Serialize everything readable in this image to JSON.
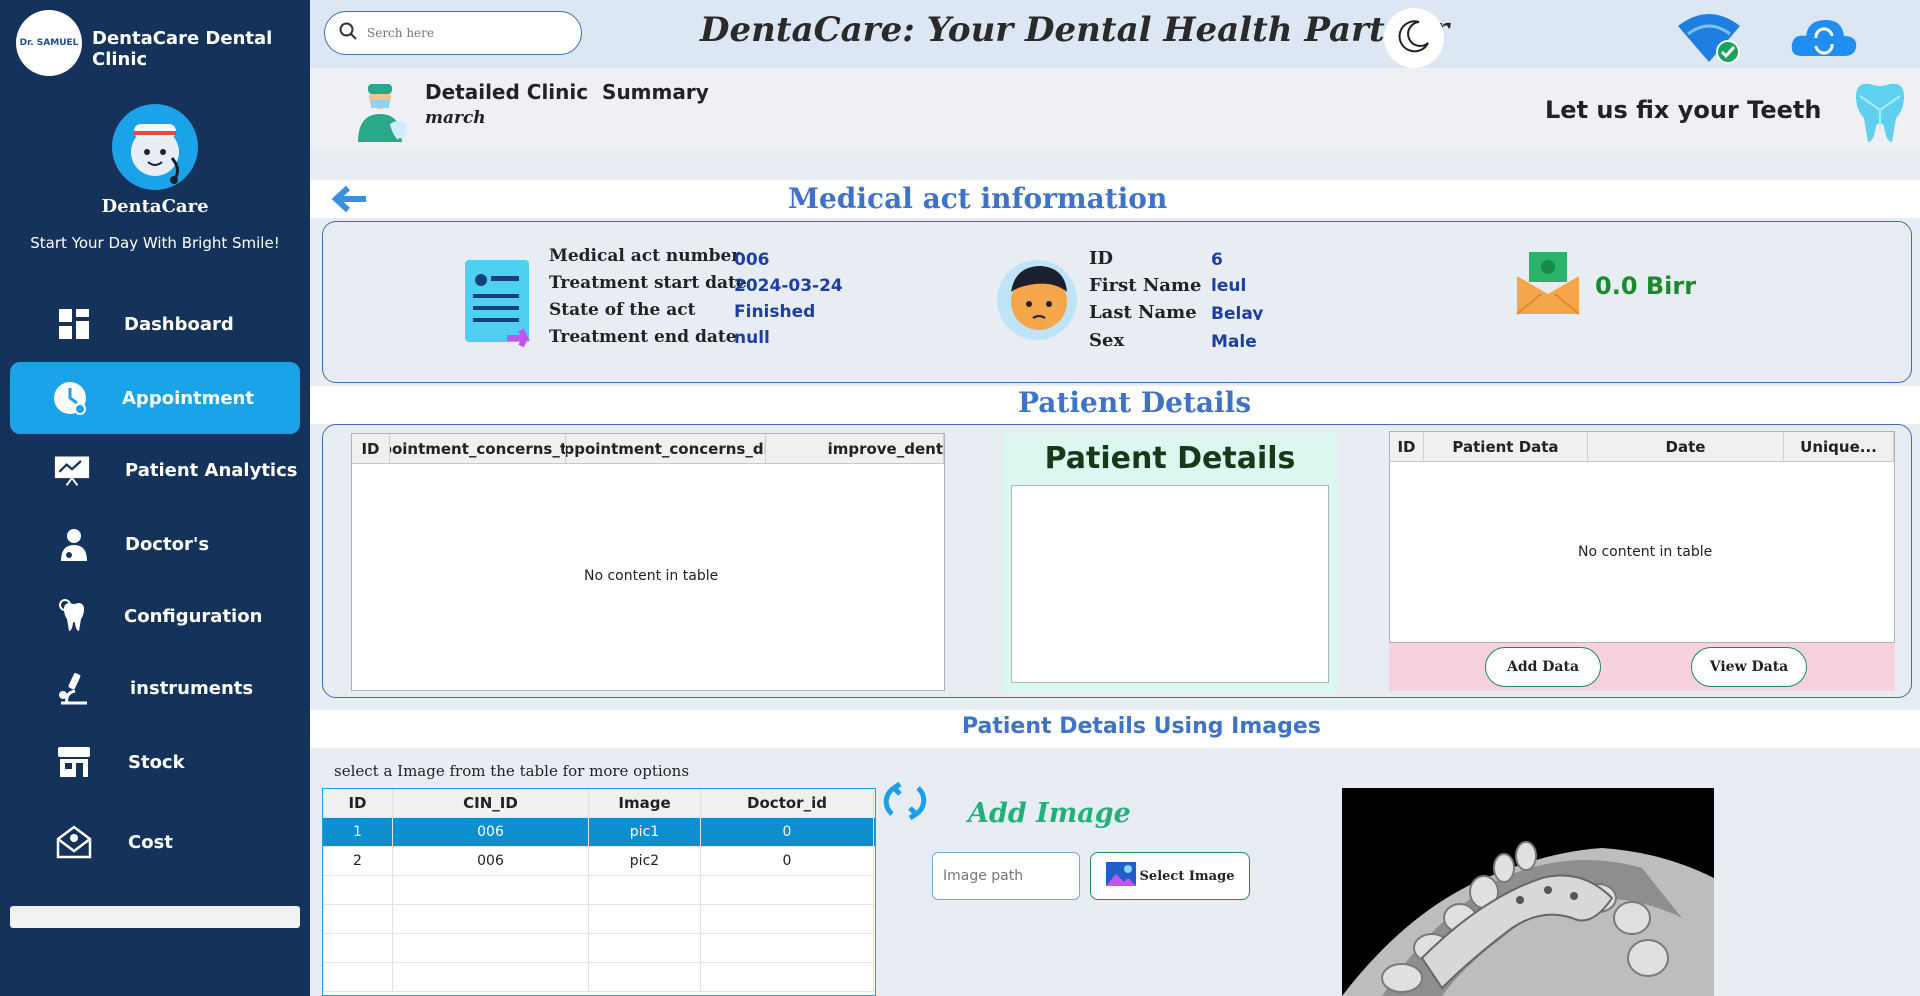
{
  "sidebar": {
    "logo_text": "Dr. SAMUEL",
    "clinic_name": "DentaCare Dental Clinic",
    "brand": "DentaCare",
    "tagline": "Start Your Day With Bright Smile!",
    "items": [
      {
        "label": "Dashboard",
        "icon": "dashboard-icon"
      },
      {
        "label": "Appointment",
        "icon": "clock-icon",
        "active": true
      },
      {
        "label": "Patient Analytics",
        "icon": "analytics-icon"
      },
      {
        "label": "Doctor's",
        "icon": "doctor-icon"
      },
      {
        "label": "Configuration",
        "icon": "tooth-gear-icon"
      },
      {
        "label": "instruments",
        "icon": "microscope-icon"
      },
      {
        "label": "Stock",
        "icon": "store-icon"
      },
      {
        "label": "Cost",
        "icon": "envelope-icon"
      }
    ]
  },
  "header": {
    "search_placeholder": "Serch here",
    "title": "DentaCare: Your Dental Health Partner"
  },
  "summary": {
    "title": "Detailed Clinic  Summary",
    "month": "march",
    "slogan": "Let us fix your Teeth"
  },
  "medical_act": {
    "title": "Medical act information",
    "fields": [
      {
        "label": "Medical act number",
        "value": "006"
      },
      {
        "label": "Treatment start date",
        "value": "2024-03-24"
      },
      {
        "label": "State of the act",
        "value": "Finished"
      },
      {
        "label": "Treatment end date",
        "value": "null"
      }
    ],
    "patient": [
      {
        "label": "ID",
        "value": "6"
      },
      {
        "label": "First Name",
        "value": "leul"
      },
      {
        "label": "Last Name",
        "value": "Belay"
      },
      {
        "label": "Sex",
        "value": "Male"
      }
    ],
    "amount": "0.0 Birr"
  },
  "patient_details": {
    "title": "Patient Details",
    "left_table": {
      "columns": [
        "ID",
        "appointment_concerns_title",
        "appointment_concerns_dis",
        "improve_dent"
      ],
      "empty": "No content in table"
    },
    "mid_title": "Patient Details",
    "right_table": {
      "columns": [
        "ID",
        "Patient Data",
        "Date",
        "Unique..."
      ],
      "empty": "No content in table"
    },
    "add_data": "Add Data",
    "view_data": "View Data"
  },
  "images": {
    "title": "Patient Details Using Images",
    "hint": "select a Image from the table for more options",
    "columns": [
      "ID",
      "CIN_ID",
      "Image",
      "Doctor_id"
    ],
    "rows": [
      [
        "1",
        "006",
        "pic1",
        "0"
      ],
      [
        "2",
        "006",
        "pic2",
        "0"
      ]
    ],
    "add_image": "Add Image",
    "path_placeholder": "Image path",
    "select_image": "Select Image"
  },
  "colors": {
    "sidebar": "#15325a",
    "accent": "#1aa3e8",
    "heading": "#3f73c8",
    "value": "#1d3fa3",
    "money": "#1b8a2a"
  }
}
